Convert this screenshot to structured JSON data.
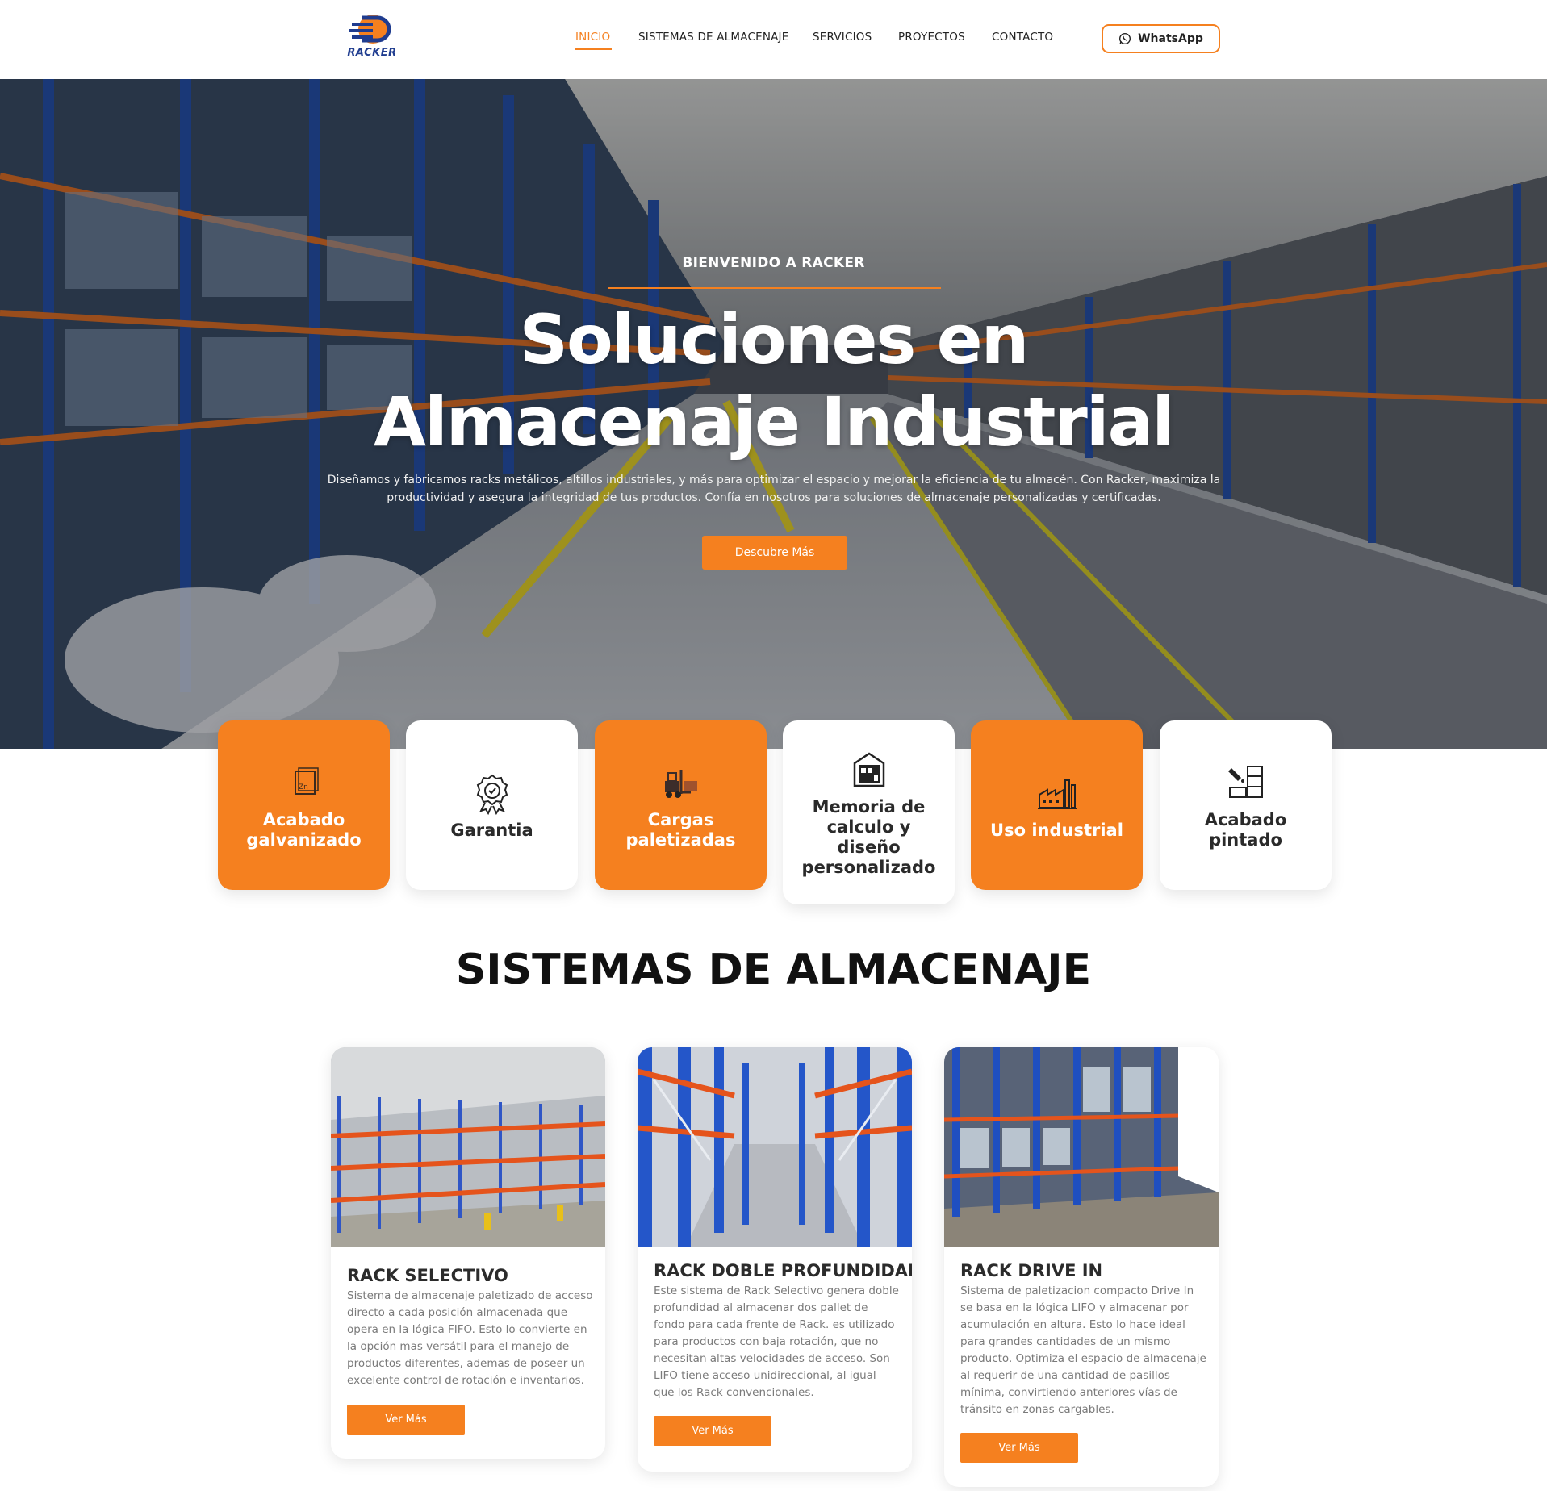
{
  "brand": {
    "logo_text": "RACKER",
    "accent": "#f5801f",
    "logo_blue": "#1f3c8f"
  },
  "nav": {
    "items": [
      {
        "label": "INICIO",
        "active": true
      },
      {
        "label": "SISTEMAS DE ALMACENAJE",
        "active": false
      },
      {
        "label": "SERVICIOS",
        "active": false
      },
      {
        "label": "PROYECTOS",
        "active": false
      },
      {
        "label": "CONTACTO",
        "active": false
      }
    ],
    "whatsapp_label": "WhatsApp",
    "whatsapp_icon": "whatsapp-icon"
  },
  "hero": {
    "kicker": "BIENVENIDO A RACKER",
    "title_line1": "Soluciones en",
    "title_line2": "Almacenaje Industrial",
    "description": "Diseñamos y fabricamos racks metálicos, altillos industriales, y más para optimizar el espacio y mejorar la eficiencia de tu almacén. Con Racker, maximiza la productividad y asegura la integridad de tus productos. Confía en nosotros para soluciones de almacenaje personalizadas y certificadas.",
    "cta_label": "Descubre Más"
  },
  "features": [
    {
      "label": "Acabado galvanizado",
      "icon": "zinc-sheet-icon",
      "style": "orange"
    },
    {
      "label": "Garantia",
      "icon": "award-badge-icon",
      "style": "white"
    },
    {
      "label": "Cargas paletizadas",
      "icon": "forklift-icon",
      "style": "orange"
    },
    {
      "label": "Memoria de calculo y diseño personalizado",
      "icon": "warehouse-building-icon",
      "style": "white"
    },
    {
      "label": "Uso industrial",
      "icon": "factory-icon",
      "style": "orange"
    },
    {
      "label": "Acabado pintado",
      "icon": "paint-rack-icon",
      "style": "white"
    }
  ],
  "section": {
    "title": "SISTEMAS DE ALMACENAJE",
    "cards": [
      {
        "title": "RACK SELECTIVO",
        "description": "Sistema de almacenaje paletizado de acceso directo a cada posición almacenada que opera en la lógica FIFO. Esto lo convierte en la opción mas versátil para el manejo de productos diferentes, ademas de poseer un excelente control de rotación e inventarios.",
        "button": "Ver Más"
      },
      {
        "title": "RACK DOBLE PROFUNDIDAD",
        "description": "Este sistema de Rack Selectivo genera doble profundidad al almacenar dos pallet de fondo para cada frente de Rack. es utilizado para productos con baja rotación, que no necesitan altas velocidades de acceso. Son LIFO tiene acceso unidireccional, al igual que los Rack convencionales.",
        "button": "Ver Más"
      },
      {
        "title": "RACK DRIVE IN",
        "description": "Sistema de paletizacion compacto Drive In se basa en la lógica LIFO y almacenar por acumulación en altura. Esto lo hace ideal para grandes cantidades de un mismo producto. Optimiza el espacio de almacenaje al requerir de una cantidad de pasillos mínima, convirtiendo anteriores vías de tránsito en zonas cargables.",
        "button": "Ver Más"
      }
    ]
  }
}
